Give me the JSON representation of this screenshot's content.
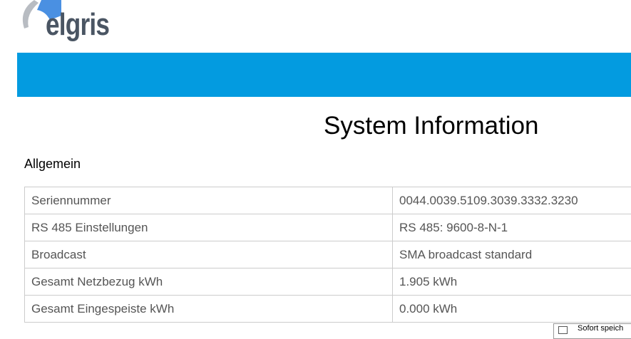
{
  "logo": {
    "text": "elgris"
  },
  "page_title": "System Information",
  "section_title": "Allgemein",
  "rows": [
    {
      "label": "Seriennummer",
      "value": "0044.0039.5109.3039.3332.3230"
    },
    {
      "label": "RS 485 Einstellungen",
      "value": "RS 485: 9600-8-N-1"
    },
    {
      "label": "Broadcast",
      "value": "SMA broadcast standard"
    },
    {
      "label": "Gesamt Netzbezug kWh",
      "value": "1.905 kWh"
    },
    {
      "label": "Gesamt Eingespeiste kWh",
      "value": "0.000 kWh"
    }
  ],
  "popup": {
    "label": "Sofort speich"
  },
  "colors": {
    "banner": "#039be0",
    "logo_text": "#4a5563",
    "logo_accent": "#4a90e2"
  }
}
